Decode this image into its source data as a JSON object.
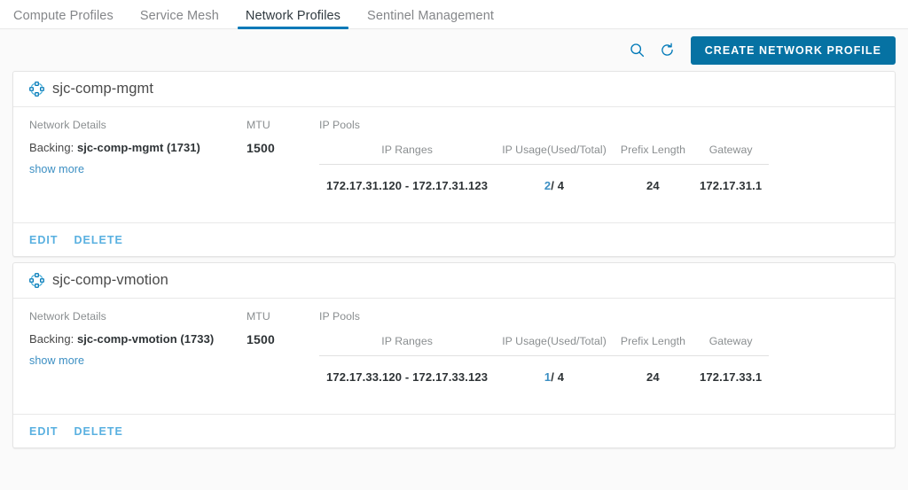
{
  "tabs": [
    {
      "label": "Compute Profiles",
      "active": false
    },
    {
      "label": "Service Mesh",
      "active": false
    },
    {
      "label": "Network Profiles",
      "active": true
    },
    {
      "label": "Sentinel Management",
      "active": false
    }
  ],
  "toolbar": {
    "search_icon": "search-icon",
    "refresh_icon": "refresh-icon",
    "create_label": "CREATE NETWORK PROFILE",
    "accent_color": "#0672a3",
    "icon_color": "#0079b8"
  },
  "table_headers": {
    "ip_ranges": "IP Ranges",
    "ip_usage": "IP Usage(Used/Total)",
    "prefix_length": "Prefix Length",
    "gateway": "Gateway"
  },
  "labels": {
    "network_details": "Network Details",
    "mtu": "MTU",
    "ip_pools": "IP Pools",
    "backing_prefix": "Backing:",
    "show_more": "show more",
    "edit": "EDIT",
    "delete": "DELETE"
  },
  "cards": [
    {
      "title": "sjc-comp-mgmt",
      "icon": "cluster-icon",
      "backing": "sjc-comp-mgmt (1731)",
      "mtu": "1500",
      "pool": {
        "ip_range": "172.17.31.120 - 172.17.31.123",
        "usage_used": "2",
        "usage_total": "/ 4",
        "prefix_length": "24",
        "gateway": "172.17.31.1"
      }
    },
    {
      "title": "sjc-comp-vmotion",
      "icon": "cluster-icon",
      "backing": "sjc-comp-vmotion (1733)",
      "mtu": "1500",
      "pool": {
        "ip_range": "172.17.33.120 - 172.17.33.123",
        "usage_used": "1",
        "usage_total": "/ 4",
        "prefix_length": "24",
        "gateway": "172.17.33.1"
      }
    }
  ]
}
